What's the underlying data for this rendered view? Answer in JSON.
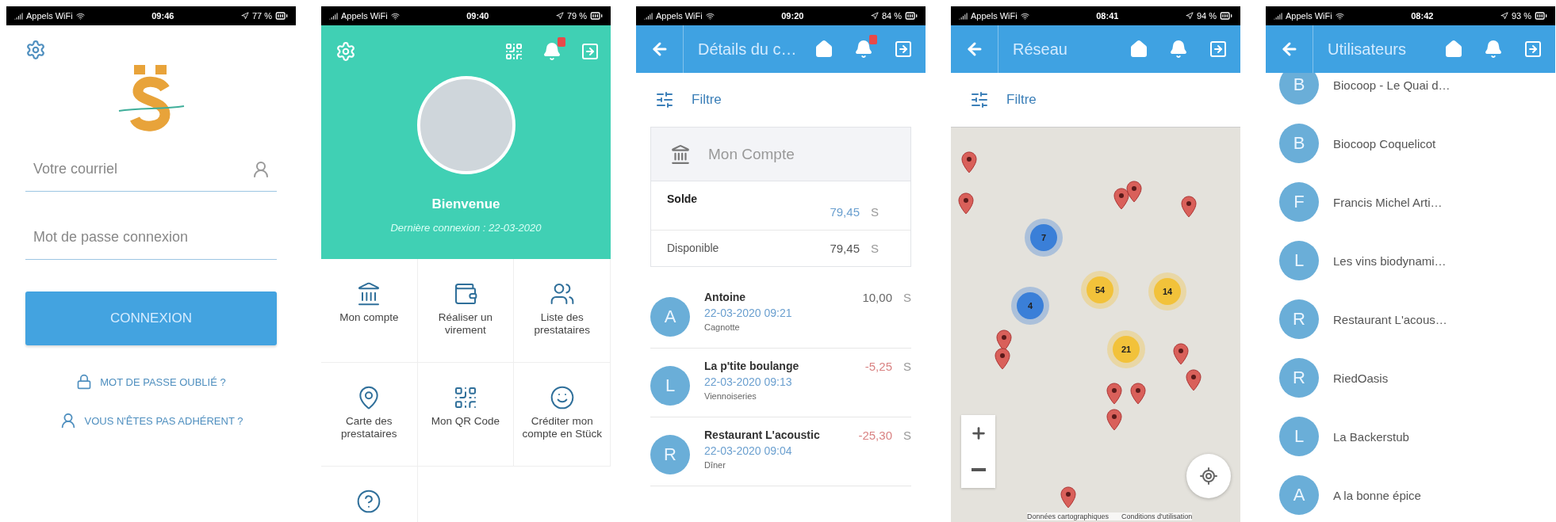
{
  "screens": [
    {
      "kind": "login",
      "status_bar": {
        "carrier": "Appels WiFi",
        "time": "09:46",
        "battery": "77 %"
      },
      "fields": [
        {
          "placeholder": "Votre courriel"
        },
        {
          "placeholder": "Mot de passe connexion"
        }
      ],
      "submit": "CONNEXION",
      "links": [
        "MOT DE PASSE OUBLIÉ ?",
        "VOUS N'ÊTES PAS ADHÉRENT ?"
      ]
    },
    {
      "kind": "home",
      "status_bar": {
        "carrier": "Appels WiFi",
        "time": "09:40",
        "battery": "79 %"
      },
      "has_notifications": true,
      "welcome": "Bienvenue",
      "last_login": "Dernière connexion : 22-03-2020",
      "tiles": [
        "Mon compte",
        "Réaliser un virement",
        "Liste des prestataires",
        "Carte des prestataires",
        "Mon QR Code",
        "Créditer mon compte en Stück"
      ]
    },
    {
      "kind": "account",
      "status_bar": {
        "carrier": "Appels WiFi",
        "time": "09:20",
        "battery": "84 %"
      },
      "title": "Détails du c…",
      "has_notifications": true,
      "filter": "Filtre",
      "card": {
        "title": "Mon Compte",
        "rows": [
          {
            "label": "Solde",
            "value": "79,45",
            "currency": "S"
          },
          {
            "label": "Disponible",
            "value": "79,45",
            "currency": "S"
          }
        ]
      },
      "transactions": [
        {
          "initial": "A",
          "name": "Antoine",
          "date": "22-03-2020 09:21",
          "category": "Cagnotte",
          "amount": "10,00",
          "currency": "S",
          "negative": false
        },
        {
          "initial": "L",
          "name": "La p'tite boulange",
          "date": "22-03-2020 09:13",
          "category": "Viennoiseries",
          "amount": "-5,25",
          "currency": "S",
          "negative": true
        },
        {
          "initial": "R",
          "name": "Restaurant L'acoustic",
          "date": "22-03-2020 09:04",
          "category": "Dîner",
          "amount": "-25,30",
          "currency": "S",
          "negative": true
        }
      ]
    },
    {
      "kind": "map",
      "status_bar": {
        "carrier": "Appels WiFi",
        "time": "08:41",
        "battery": "94 %"
      },
      "title": "Réseau",
      "has_notifications": false,
      "filter": "Filtre",
      "clusters": [
        {
          "count": "7",
          "color": "#3a7fd8"
        },
        {
          "count": "4",
          "color": "#3a7fd8"
        },
        {
          "count": "54",
          "color": "#f2c23a"
        },
        {
          "count": "14",
          "color": "#f2c23a"
        },
        {
          "count": "21",
          "color": "#f2c23a"
        }
      ],
      "attribution": [
        "Données cartographiques",
        "Conditions d'utilisation"
      ]
    },
    {
      "kind": "users",
      "status_bar": {
        "carrier": "Appels WiFi",
        "time": "08:42",
        "battery": "93 %"
      },
      "title": "Utilisateurs",
      "has_notifications": false,
      "users": [
        {
          "initial": "B",
          "name": "Biocoop - Le Quai d…"
        },
        {
          "initial": "B",
          "name": "Biocoop Coquelicot"
        },
        {
          "initial": "F",
          "name": "Francis Michel Arti…"
        },
        {
          "initial": "L",
          "name": "Les vins biodynami…"
        },
        {
          "initial": "R",
          "name": "Restaurant L'acous…"
        },
        {
          "initial": "R",
          "name": "RiedOasis"
        },
        {
          "initial": "L",
          "name": "La Backerstub"
        },
        {
          "initial": "A",
          "name": "A la bonne épice"
        }
      ]
    }
  ]
}
